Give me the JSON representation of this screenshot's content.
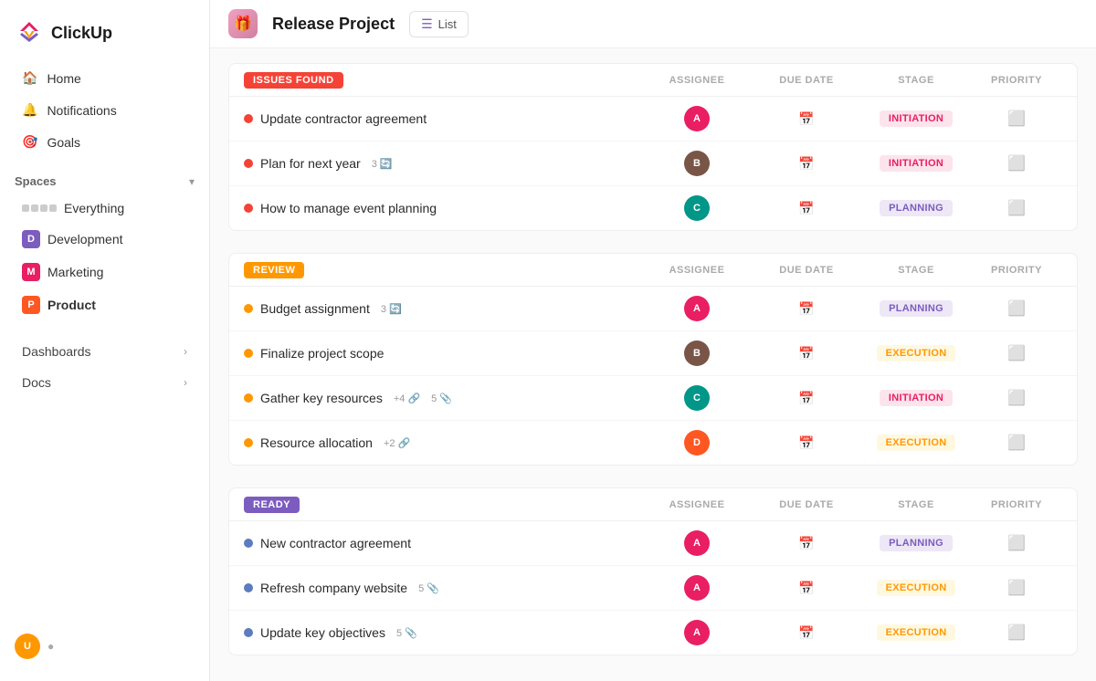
{
  "app": {
    "logo": "ClickUp"
  },
  "sidebar": {
    "nav": [
      {
        "id": "home",
        "label": "Home",
        "icon": "🏠"
      },
      {
        "id": "notifications",
        "label": "Notifications",
        "icon": "🔔"
      },
      {
        "id": "goals",
        "label": "Goals",
        "icon": "🎯"
      }
    ],
    "spaces_label": "Spaces",
    "spaces": [
      {
        "id": "everything",
        "label": "Everything",
        "type": "everything"
      },
      {
        "id": "development",
        "label": "Development",
        "color": "#7c5cbf",
        "letter": "D"
      },
      {
        "id": "marketing",
        "label": "Marketing",
        "color": "#e91e63",
        "letter": "M"
      },
      {
        "id": "product",
        "label": "Product",
        "color": "#ff5722",
        "letter": "P",
        "active": true
      }
    ],
    "bottom_nav": [
      {
        "id": "dashboards",
        "label": "Dashboards"
      },
      {
        "id": "docs",
        "label": "Docs"
      }
    ]
  },
  "topbar": {
    "project_name": "Release Project",
    "view_label": "List"
  },
  "columns": {
    "assignee": "ASSIGNEE",
    "due_date": "DUE DATE",
    "stage": "STAGE",
    "priority": "PRIORITY"
  },
  "sections": [
    {
      "id": "issues",
      "badge_label": "ISSUES FOUND",
      "badge_type": "issues",
      "tasks": [
        {
          "name": "Update contractor agreement",
          "dot": "red",
          "avatar_color": "av-pink",
          "stage": "INITIATION",
          "stage_type": "initiation"
        },
        {
          "name": "Plan for next year",
          "dot": "red",
          "badge": "3",
          "has_recur": true,
          "avatar_color": "av-brown",
          "stage": "INITIATION",
          "stage_type": "initiation"
        },
        {
          "name": "How to manage event planning",
          "dot": "red",
          "avatar_color": "av-teal",
          "stage": "PLANNING",
          "stage_type": "planning"
        }
      ]
    },
    {
      "id": "review",
      "badge_label": "REVIEW",
      "badge_type": "review",
      "tasks": [
        {
          "name": "Budget assignment",
          "dot": "yellow",
          "badge": "3",
          "has_recur": true,
          "avatar_color": "av-pink",
          "stage": "PLANNING",
          "stage_type": "planning"
        },
        {
          "name": "Finalize project scope",
          "dot": "yellow",
          "avatar_color": "av-brown",
          "stage": "EXECUTION",
          "stage_type": "execution"
        },
        {
          "name": "Gather key resources",
          "dot": "yellow",
          "badge": "+4",
          "has_link": true,
          "attach": "5",
          "avatar_color": "av-teal",
          "stage": "INITIATION",
          "stage_type": "initiation"
        },
        {
          "name": "Resource allocation",
          "dot": "yellow",
          "badge": "+2",
          "has_link": true,
          "avatar_color": "av-orange",
          "stage": "EXECUTION",
          "stage_type": "execution"
        }
      ]
    },
    {
      "id": "ready",
      "badge_label": "READY",
      "badge_type": "ready",
      "tasks": [
        {
          "name": "New contractor agreement",
          "dot": "blue",
          "avatar_color": "av-pink",
          "stage": "PLANNING",
          "stage_type": "planning"
        },
        {
          "name": "Refresh company website",
          "dot": "blue",
          "attach": "5",
          "avatar_color": "av-pink",
          "stage": "EXECUTION",
          "stage_type": "execution"
        },
        {
          "name": "Update key objectives",
          "dot": "blue",
          "attach": "5",
          "avatar_color": "av-pink",
          "stage": "EXECUTION",
          "stage_type": "execution"
        }
      ]
    }
  ]
}
